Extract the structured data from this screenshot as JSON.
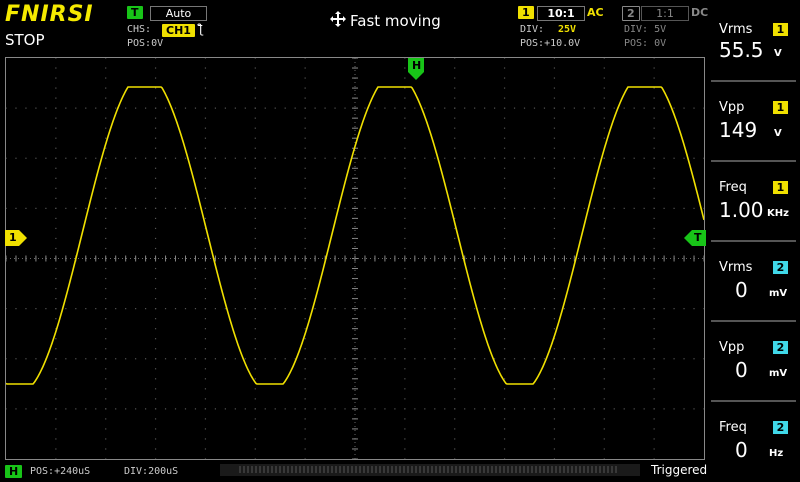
{
  "header": {
    "brand": "FNIRSI",
    "run_state": "STOP",
    "center_mode": "Fast moving",
    "center_icon": "move-arrows-icon"
  },
  "trigger": {
    "badge": "T",
    "mode": "Auto",
    "channel_label": "CHS:",
    "channel": "CH1",
    "edge_symbol": "ƪ",
    "pos": "POS:0V"
  },
  "ch1": {
    "badge": "1",
    "probe": "10:1",
    "coupling": "AC",
    "div_label": "DIV:",
    "div": "25V",
    "pos": "POS:+10.0V",
    "color": "#f0e000"
  },
  "ch2": {
    "badge": "2",
    "probe": "1:1",
    "coupling": "DC",
    "div": "DIV: 5V",
    "pos": "POS: 0V",
    "color": "#40d8e8"
  },
  "plot": {
    "marker_h": "H",
    "marker_ch1": "1",
    "marker_trigger": "T",
    "waveform_color": "#f0e000",
    "grid_divisions": {
      "horizontal": 14,
      "vertical": 8
    }
  },
  "measurements": [
    {
      "name": "Vrms",
      "channel": "1",
      "value": "55.5",
      "unit": "V"
    },
    {
      "name": "Vpp",
      "channel": "1",
      "value": "149",
      "unit": "V"
    },
    {
      "name": "Freq",
      "channel": "1",
      "value": "1.00",
      "unit": "KHz"
    },
    {
      "name": "Vrms",
      "channel": "2",
      "value": "0",
      "unit": "mV"
    },
    {
      "name": "Vpp",
      "channel": "2",
      "value": "0",
      "unit": "mV"
    },
    {
      "name": "Freq",
      "channel": "2",
      "value": "0",
      "unit": "Hz"
    }
  ],
  "timebase": {
    "badge": "H",
    "pos": "POS:+240uS",
    "div": "DIV:200uS"
  },
  "status": "Triggered"
}
